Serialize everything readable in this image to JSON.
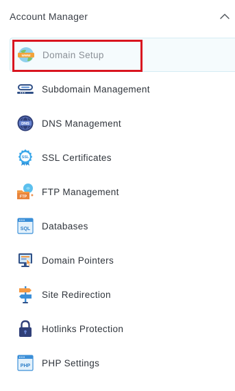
{
  "panel": {
    "title": "Account Manager",
    "collapse_icon": "chevron-up-icon"
  },
  "menu": {
    "items": [
      {
        "label": "Domain Setup",
        "icon": "globe-www-icon",
        "active": true
      },
      {
        "label": "Subdomain Management",
        "icon": "subdomain-link-icon"
      },
      {
        "label": "DNS Management",
        "icon": "dns-globe-icon"
      },
      {
        "label": "SSL Certificates",
        "icon": "ssl-badge-icon"
      },
      {
        "label": "FTP Management",
        "icon": "ftp-folder-icon"
      },
      {
        "label": "Databases",
        "icon": "sql-database-icon"
      },
      {
        "label": "Domain Pointers",
        "icon": "monitor-pointer-icon"
      },
      {
        "label": "Site Redirection",
        "icon": "signpost-icon"
      },
      {
        "label": "Hotlinks Protection",
        "icon": "padlock-icon"
      },
      {
        "label": "PHP Settings",
        "icon": "php-file-icon"
      }
    ],
    "icon_texts": {
      "www": "www",
      "dns": "DNS",
      "ssl": "SSL",
      "ftp": "FTP",
      "sql": "SQL",
      "php": "PHP"
    }
  },
  "colors": {
    "highlight_border": "#d9141f",
    "active_bg": "#f5fbfd",
    "text": "#2f343b"
  }
}
